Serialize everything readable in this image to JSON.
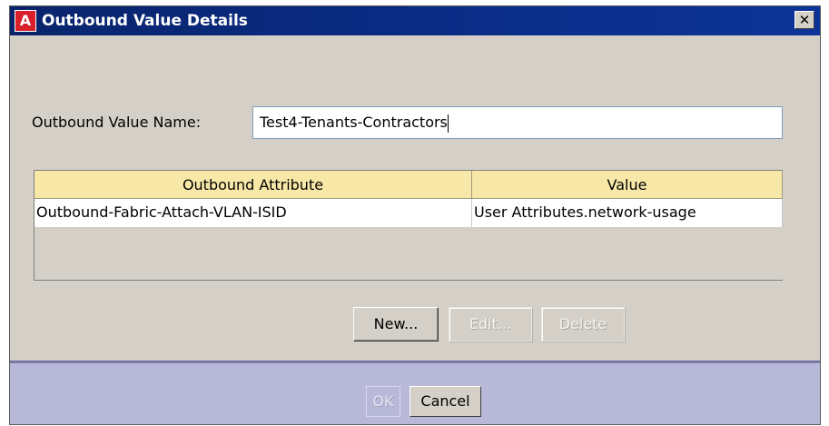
{
  "window": {
    "title": "Outbound Value Details",
    "app_icon_glyph": "A",
    "close_glyph": "✕"
  },
  "form": {
    "name_label": "Outbound Value Name:",
    "name_value": "Test4-Tenants-Contractors"
  },
  "table": {
    "columns": [
      "Outbound Attribute",
      "Value"
    ],
    "rows": [
      [
        "Outbound-Fabric-Attach-VLAN-ISID",
        "User Attributes.network-usage"
      ]
    ],
    "header_color": "#f8e8a8"
  },
  "buttons": {
    "new": "New...",
    "edit": "Edit...",
    "delete": "Delete"
  },
  "footer": {
    "ok": "OK",
    "cancel": "Cancel"
  },
  "colors": {
    "titlebar": "#0a2a80",
    "panel": "#d4d0c8",
    "footer": "#b8b8d8",
    "app_icon": "#d8202a"
  }
}
